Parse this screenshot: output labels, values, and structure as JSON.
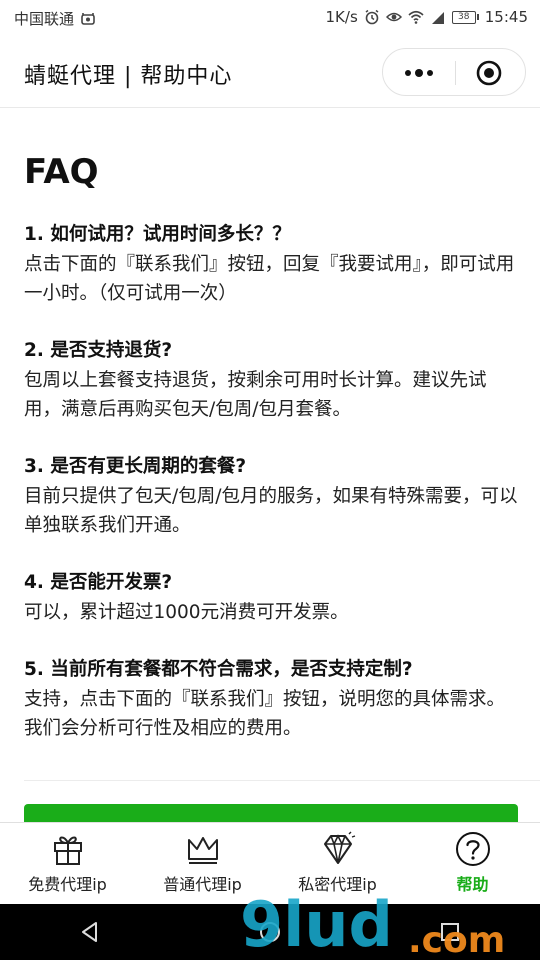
{
  "status_bar": {
    "carrier": "中国联通",
    "speed": "1K/s",
    "battery": "38",
    "time": "15:45"
  },
  "nav": {
    "title": "蜻蜓代理 | 帮助中心"
  },
  "faq": {
    "title": "FAQ",
    "items": [
      {
        "q": "1. 如何试用？试用时间多长？？",
        "a": "点击下面的『联系我们』按钮，回复『我要试用』，即可试用一小时。（仅可试用一次）"
      },
      {
        "q": "2. 是否支持退货?",
        "a": "包周以上套餐支持退货，按剩余可用时长计算。建议先试用，满意后再购买包天/包周/包月套餐。"
      },
      {
        "q": "3. 是否有更长周期的套餐?",
        "a": "目前只提供了包天/包周/包月的服务，如果有特殊需要，可以单独联系我们开通。"
      },
      {
        "q": "4. 是否能开发票?",
        "a": "可以，累计超过1000元消费可开发票。"
      },
      {
        "q": "5. 当前所有套餐都不符合需求，是否支持定制?",
        "a": "支持，点击下面的『联系我们』按钮，说明您的具体需求。我们会分析可行性及相应的费用。"
      }
    ]
  },
  "tabbar": {
    "tabs": [
      {
        "label": "免费代理ip",
        "icon": "gift-icon",
        "active": false
      },
      {
        "label": "普通代理ip",
        "icon": "crown-icon",
        "active": false
      },
      {
        "label": "私密代理ip",
        "icon": "diamond-icon",
        "active": false
      },
      {
        "label": "帮助",
        "icon": "help-icon",
        "active": true
      }
    ],
    "active_color": "#1aad19"
  },
  "colors": {
    "accent": "#1aad19"
  },
  "watermark": {
    "text": "9lud.com"
  }
}
